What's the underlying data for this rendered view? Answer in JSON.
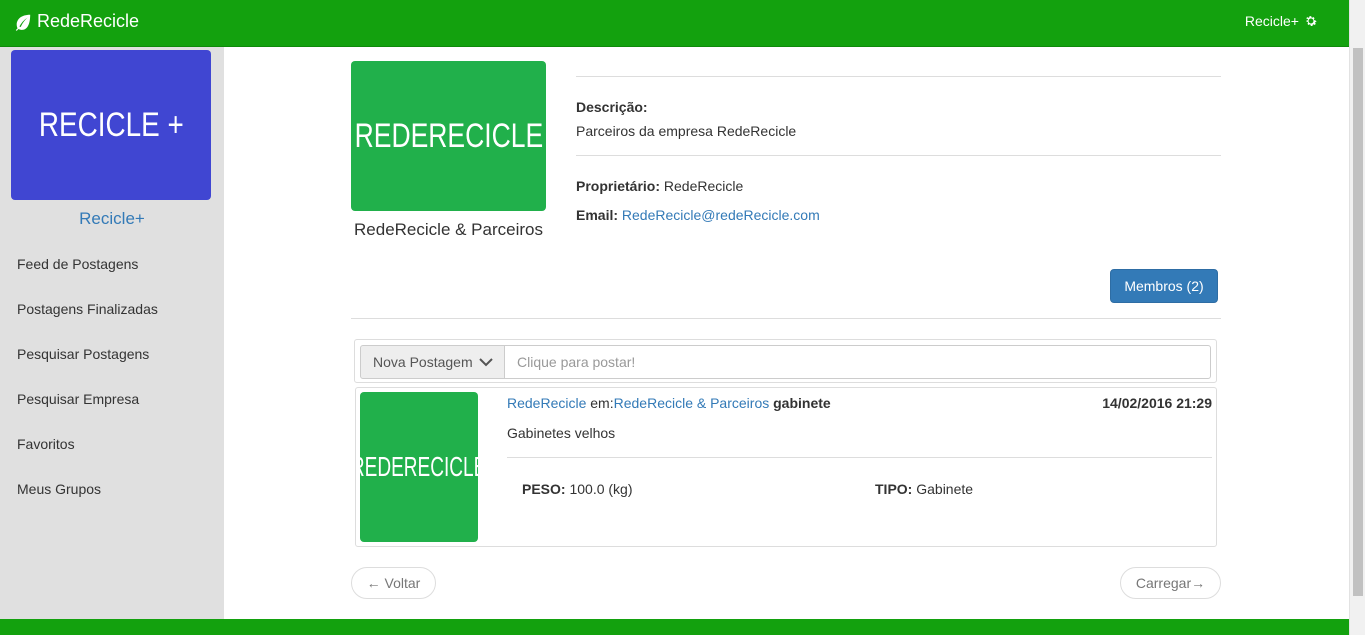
{
  "navbar": {
    "brand": "RedeRecicle",
    "brand_icon": "leaf-icon",
    "user": "Recicle+",
    "user_icon": "gear-icon",
    "color": "#13a10e"
  },
  "sidebar": {
    "logo_text": "RECICLE +",
    "logo_color": "#4046d2",
    "name": "Recicle+",
    "items": [
      {
        "label": "Feed de Postagens"
      },
      {
        "label": "Postagens Finalizadas"
      },
      {
        "label": "Pesquisar Postagens"
      },
      {
        "label": "Pesquisar Empresa"
      },
      {
        "label": "Favoritos"
      },
      {
        "label": "Meus Grupos"
      }
    ]
  },
  "group": {
    "logo_text": "REDERECICLE",
    "logo_color": "#21b04b",
    "name": "RedeRecicle & Parceiros",
    "description_label": "Descrição:",
    "description": "Parceiros da empresa RedeRecicle",
    "owner_label": "Proprietário:",
    "owner": "RedeRecicle",
    "email_label": "Email:",
    "email": "RedeRecicle@redeRecicle.com",
    "members_button": "Membros (2)"
  },
  "composer": {
    "type_button": "Nova Postagem",
    "placeholder": "Clique para postar!"
  },
  "posts": [
    {
      "image_text": "REDERECICLE",
      "author": "RedeRecicle",
      "in_label": "em:",
      "group": "RedeRecicle & Parceiros",
      "title": "gabinete",
      "date": "14/02/2016 21:29",
      "body": "Gabinetes velhos",
      "peso_label": "PESO:",
      "peso": "100.0 (kg)",
      "tipo_label": "TIPO:",
      "tipo": "Gabinete"
    }
  ],
  "pager": {
    "back": "← Voltar",
    "load": "Carregar→"
  }
}
